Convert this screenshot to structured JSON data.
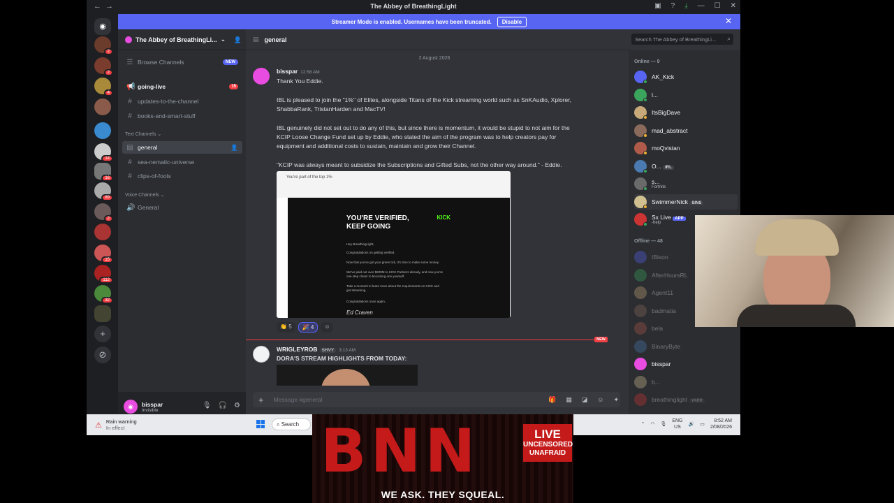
{
  "window": {
    "title": "The Abbey of BreathingLight"
  },
  "streamer_banner": {
    "text": "Streamer Mode is enabled. Usernames have been truncated.",
    "button": "Disable",
    "close": "✕"
  },
  "guild_badges": [
    "2",
    "2",
    "4",
    "14",
    "16",
    "2",
    "89",
    "15",
    "112",
    "32"
  ],
  "server": {
    "name": "The Abbey of BreathingLi...",
    "browse": "Browse Channels",
    "browse_badge": "NEW",
    "channels_top": [
      {
        "name": "going-live",
        "badge": "15"
      },
      {
        "name": "updates-to-the-channel"
      },
      {
        "name": "books-and-smart-stuff"
      }
    ],
    "text_category": "Text Channels",
    "text_channels": [
      "general",
      "sea-nematic-universe",
      "clips-of-fools"
    ],
    "voice_category": "Voice Channels",
    "voice_channels": [
      "General"
    ]
  },
  "user": {
    "name": "bisspar",
    "status": "Invisible"
  },
  "chat": {
    "channel": "general",
    "search_placeholder": "Search The Abbey of BreathingLi...",
    "date_divider": "2 August 2026",
    "msg1": {
      "author": "bisspar",
      "time": "12:58 AM",
      "lines": [
        "Thank You Eddie.",
        "IBL is pleased to join the \"1%\" of Elites, alongside Titans of the Kick streaming world such as SnKAudio, Xplorer,",
        "ShabbaRank, TristanHarden and MacTV!",
        "IBL genuinely did not set out to do any of this, but since there is momentum, it would be stupid to not aim for the",
        "KCIP Loose Change Fund set up by Eddie, who stated the aim of the program was to help creators pay for",
        "equipment and additional costs to sustain, maintain and grow their Channel.",
        "\"KCIP was always meant to subsidize the Subscriptions and Gifted Subs, not the other way around.\" - Eddie."
      ],
      "image": {
        "subject": "You're part of the top 1%",
        "heading1": "YOU'RE VERIFIED,",
        "heading2": "KEEP GOING",
        "brand": "KICK",
        "lines": [
          "Hey BreathingLight,",
          "Congratulations on getting verified.",
          "Now that you've got your green tick, it's time to make some money.",
          "We've paid out over $200M to KICK Partners already, and now you're",
          "one step closer to becoming one yourself.",
          "Take a moment to learn more about the requirements on KICK and",
          "get streaming.",
          "Congratulations once again,"
        ],
        "signature": "Ed Craven"
      },
      "reactions": [
        {
          "emoji": "👏",
          "count": "5"
        },
        {
          "emoji": "🎉",
          "count": "4"
        }
      ]
    },
    "new_label": "NEW",
    "msg2": {
      "author": "WRIGLEYROB",
      "tag": "SHVY",
      "time": "3:13 AM",
      "line": "DORA'S STREAM HIGHLIGHTS FROM TODAY:"
    },
    "composer_placeholder": "Message #general"
  },
  "members": {
    "online_header": "Online — 9",
    "online": [
      {
        "name": "AK_Kick",
        "color": "#3ba55d"
      },
      {
        "name": "l...",
        "color": "#3ba55d"
      },
      {
        "name": "ItsBigDave",
        "color": "#f0b232"
      },
      {
        "name": "mad_abstract",
        "color": "#f0b232"
      },
      {
        "name": "moQvistan",
        "color": "#f0b232"
      },
      {
        "name": "O...",
        "color": "#3ba55d",
        "badge": "IRL"
      },
      {
        "name": "s...",
        "color": "#3ba55d",
        "sub": "Fortnite"
      },
      {
        "name": "SwimmerNick",
        "color": "#f0b232",
        "badge": "SINS"
      },
      {
        "name": "Sx Live",
        "color": "#3ba55d",
        "app": "APP",
        "sub": "-help"
      }
    ],
    "offline_header": "Offline — 48",
    "offline": [
      {
        "name": "IBison"
      },
      {
        "name": "AfterHoursRL"
      },
      {
        "name": "Agent11"
      },
      {
        "name": "badmatia"
      },
      {
        "name": "bela"
      },
      {
        "name": "BinaryByte"
      },
      {
        "name": "bisspar"
      },
      {
        "name": "b..."
      },
      {
        "name": "breathinglight",
        "badge": "YARR"
      }
    ]
  },
  "taskbar": {
    "weather_title": "Rain warning",
    "weather_sub": "In effect",
    "search": "Search",
    "lang": "ENG",
    "region": "US",
    "time": "8:52 AM",
    "date": "2/08/2026"
  },
  "bnn": {
    "letters": "BNN",
    "live": "LIVE",
    "uncensored": "UNCENSORED",
    "unafraid": "UNAFRAID",
    "slogan": "WE ASK. THEY SQUEAL."
  }
}
